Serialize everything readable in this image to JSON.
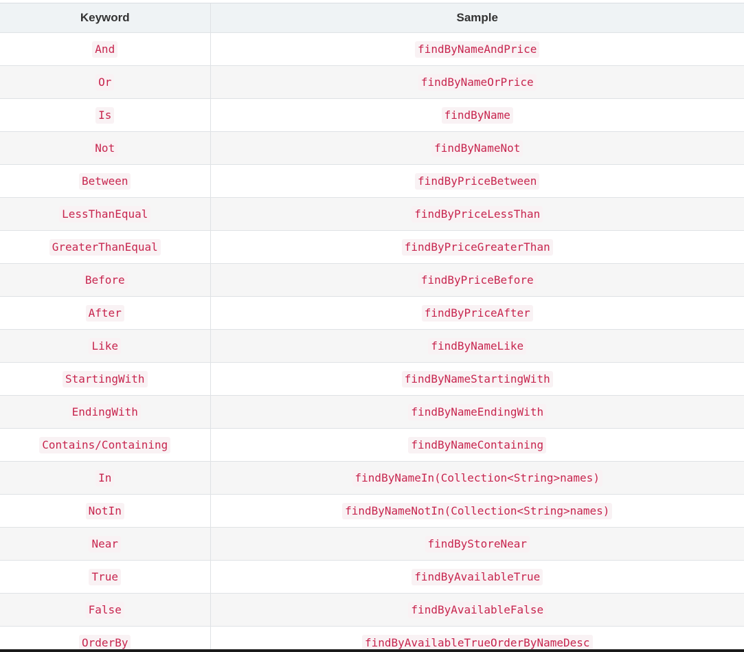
{
  "table": {
    "headers": [
      "Keyword",
      "Sample"
    ],
    "rows": [
      {
        "keyword": "And",
        "sample": "findByNameAndPrice"
      },
      {
        "keyword": "Or",
        "sample": "findByNameOrPrice"
      },
      {
        "keyword": "Is",
        "sample": "findByName"
      },
      {
        "keyword": "Not",
        "sample": "findByNameNot"
      },
      {
        "keyword": "Between",
        "sample": "findByPriceBetween"
      },
      {
        "keyword": "LessThanEqual",
        "sample": "findByPriceLessThan"
      },
      {
        "keyword": "GreaterThanEqual",
        "sample": "findByPriceGreaterThan"
      },
      {
        "keyword": "Before",
        "sample": "findByPriceBefore"
      },
      {
        "keyword": "After",
        "sample": "findByPriceAfter"
      },
      {
        "keyword": "Like",
        "sample": "findByNameLike"
      },
      {
        "keyword": "StartingWith",
        "sample": "findByNameStartingWith"
      },
      {
        "keyword": "EndingWith",
        "sample": "findByNameEndingWith"
      },
      {
        "keyword": "Contains/Containing",
        "sample": "findByNameContaining"
      },
      {
        "keyword": "In",
        "sample": "findByNameIn(Collection<String>names)"
      },
      {
        "keyword": "NotIn",
        "sample": "findByNameNotIn(Collection<String>names)"
      },
      {
        "keyword": "Near",
        "sample": "findByStoreNear"
      },
      {
        "keyword": "True",
        "sample": "findByAvailableTrue"
      },
      {
        "keyword": "False",
        "sample": "findByAvailableFalse"
      },
      {
        "keyword": "OrderBy",
        "sample": "findByAvailableTrueOrderByNameDesc"
      }
    ]
  },
  "colors": {
    "header_bg": "#eff3f5",
    "row_alt_bg": "#f6f6f6",
    "code_text": "#c7254e",
    "code_bg": "#f9f2f4",
    "border": "#dfe2e5"
  }
}
